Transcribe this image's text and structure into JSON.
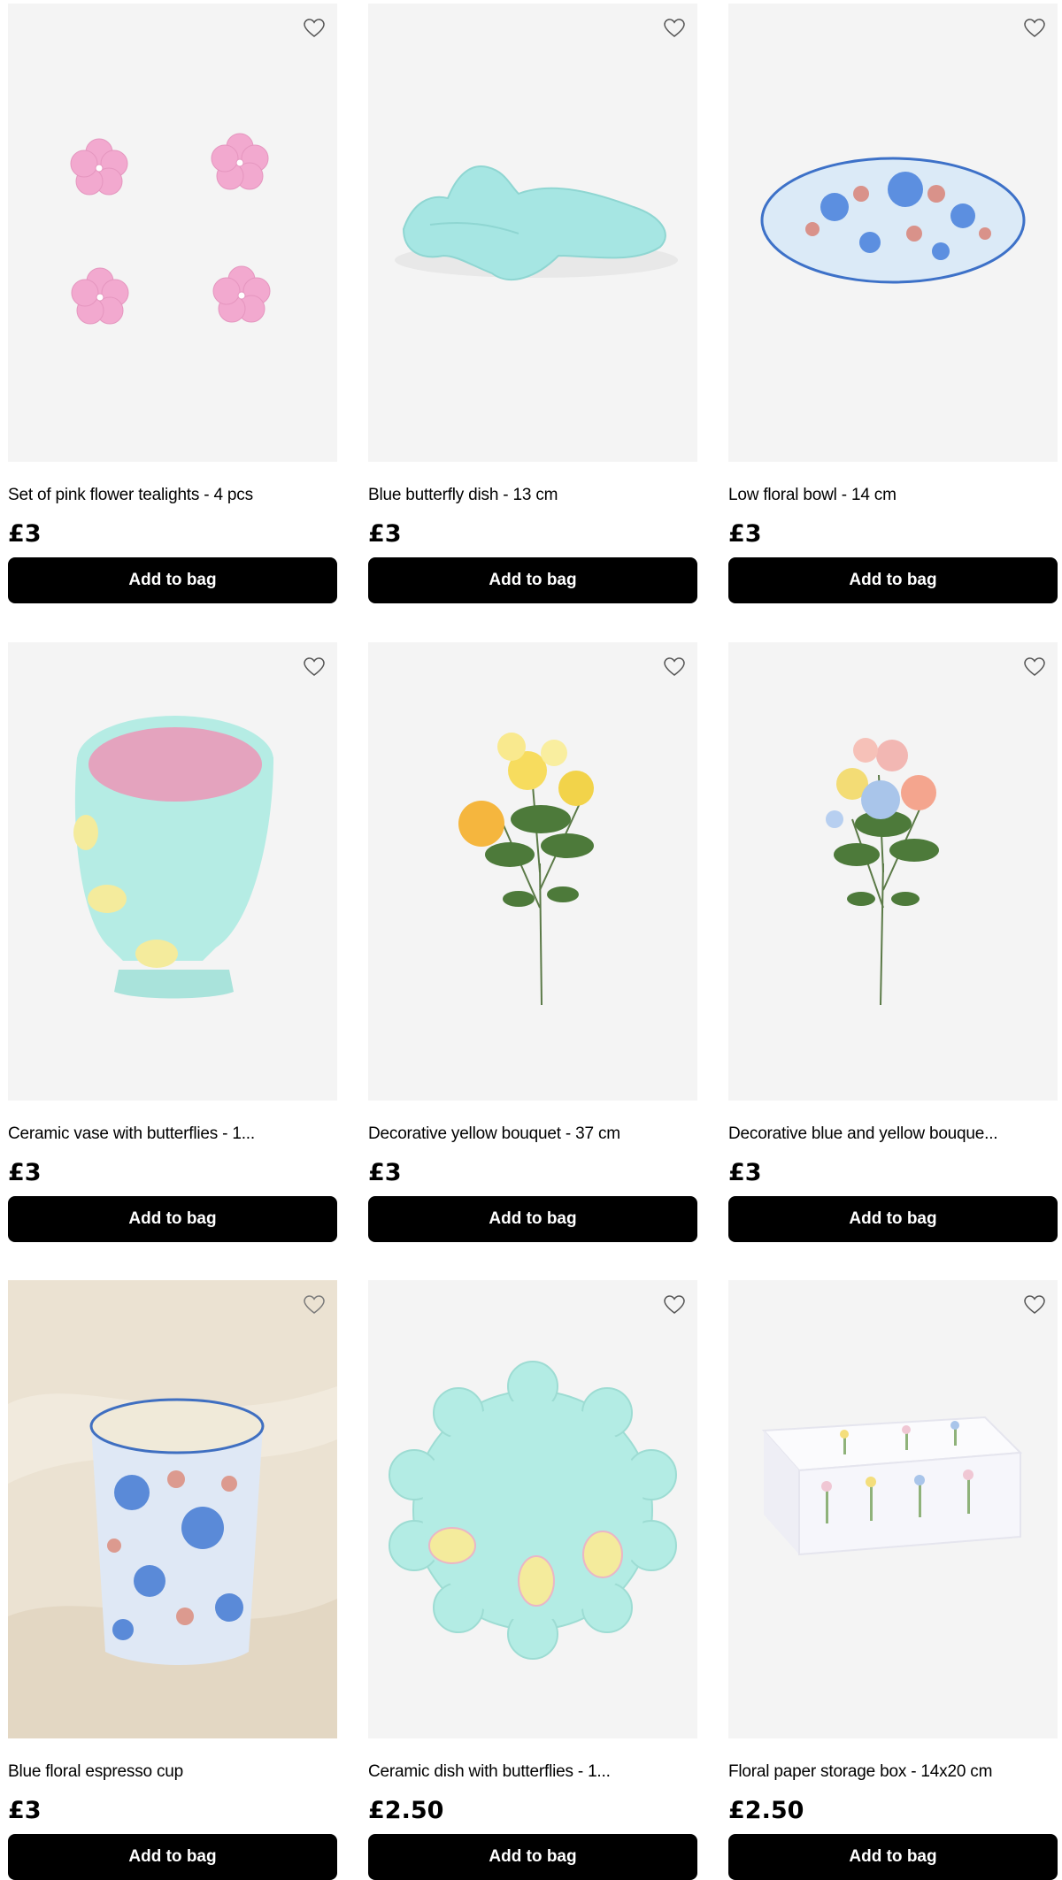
{
  "add_to_bag_label": "Add to bag",
  "products": [
    {
      "title": "Set of pink flower tealights - 4 pcs",
      "price": "£3",
      "image_icon": "pink-flower-tealights-image"
    },
    {
      "title": "Blue butterfly dish - 13 cm",
      "price": "£3",
      "image_icon": "blue-butterfly-dish-image"
    },
    {
      "title": "Low floral bowl - 14 cm",
      "price": "£3",
      "image_icon": "floral-bowl-image"
    },
    {
      "title": "Ceramic vase with butterflies - 1...",
      "price": "£3",
      "image_icon": "ceramic-vase-image"
    },
    {
      "title": "Decorative yellow bouquet - 37 cm",
      "price": "£3",
      "image_icon": "yellow-bouquet-image"
    },
    {
      "title": "Decorative blue and yellow bouque...",
      "price": "£3",
      "image_icon": "blue-yellow-bouquet-image"
    },
    {
      "title": "Blue floral espresso cup",
      "price": "£3",
      "image_icon": "espresso-cup-image"
    },
    {
      "title": "Ceramic dish with butterflies - 1...",
      "price": "£2.50",
      "image_icon": "butterfly-dish-image"
    },
    {
      "title": "Floral paper storage box - 14x20 cm",
      "price": "£2.50",
      "image_icon": "storage-box-image"
    }
  ],
  "colors": {
    "button_bg": "#000000",
    "button_text": "#ffffff",
    "image_bg": "#f4f4f4"
  }
}
